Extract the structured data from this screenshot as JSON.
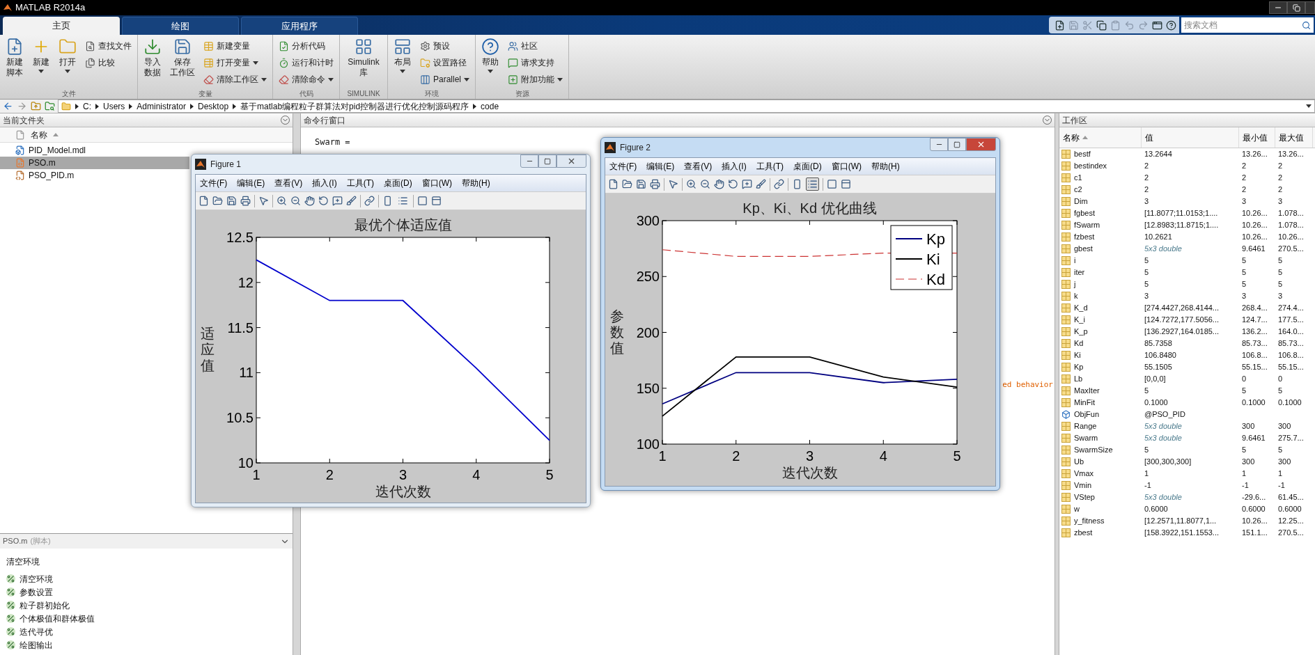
{
  "window": {
    "title": "MATLAB R2014a"
  },
  "tabs": [
    {
      "label": "主页",
      "selected": true
    },
    {
      "label": "绘图",
      "selected": false
    },
    {
      "label": "应用程序",
      "selected": false
    }
  ],
  "search": {
    "placeholder": "搜索文档"
  },
  "ribbon": {
    "groups": [
      {
        "label": "文件",
        "items": [
          {
            "kind": "large",
            "label": "新建脚本",
            "menu": false
          },
          {
            "kind": "large",
            "label": "新建",
            "menu": true
          },
          {
            "kind": "large",
            "label": "打开",
            "menu": true
          },
          {
            "kind": "small",
            "label": "查找文件",
            "menu": false
          },
          {
            "kind": "small",
            "label": "比较",
            "menu": false
          }
        ]
      },
      {
        "label": "变量",
        "items": [
          {
            "kind": "large",
            "label": "导入数据",
            "menu": false
          },
          {
            "kind": "large",
            "label": "保存工作区",
            "menu": false
          },
          {
            "kind": "small",
            "label": "新建变量",
            "menu": false
          },
          {
            "kind": "small",
            "label": "打开变量",
            "menu": true
          },
          {
            "kind": "small",
            "label": "清除工作区",
            "menu": true
          }
        ]
      },
      {
        "label": "代码",
        "items": [
          {
            "kind": "small",
            "label": "分析代码",
            "menu": false
          },
          {
            "kind": "small",
            "label": "运行和计时",
            "menu": false
          },
          {
            "kind": "small",
            "label": "清除命令",
            "menu": true
          }
        ]
      },
      {
        "label": "SIMULINK",
        "items": [
          {
            "kind": "large",
            "label": "Simulink 库",
            "menu": false
          }
        ]
      },
      {
        "label": "环境",
        "items": [
          {
            "kind": "large",
            "label": "布局",
            "menu": true
          },
          {
            "kind": "small",
            "label": "预设",
            "menu": false
          },
          {
            "kind": "small",
            "label": "设置路径",
            "menu": false
          },
          {
            "kind": "small",
            "label": "Parallel",
            "menu": true
          }
        ]
      },
      {
        "label": "资源",
        "items": [
          {
            "kind": "large",
            "label": "帮助",
            "menu": true
          },
          {
            "kind": "small",
            "label": "社区",
            "menu": false
          },
          {
            "kind": "small",
            "label": "请求支持",
            "menu": false
          },
          {
            "kind": "small",
            "label": "附加功能",
            "menu": true
          }
        ]
      }
    ]
  },
  "address_bar": {
    "crumbs": [
      "C:",
      "Users",
      "Administrator",
      "Desktop",
      "基于matlab编程粒子群算法对pid控制器进行优化控制源码程序",
      "code"
    ]
  },
  "current_folder": {
    "title": "当前文件夹",
    "column": "名称",
    "files": [
      {
        "name": "PID_Model.mdl",
        "kind": "model",
        "selected": false
      },
      {
        "name": "PSO.m",
        "kind": "script",
        "selected": true
      },
      {
        "name": "PSO_PID.m",
        "kind": "function",
        "selected": false
      }
    ]
  },
  "details": {
    "file": "PSO.m",
    "type": "(脚本)",
    "heading": "清空环境",
    "cells": [
      "清空环境",
      "参数设置",
      "粒子群初始化",
      "个体极值和群体极值",
      "迭代寻优",
      "绘图输出"
    ]
  },
  "command_window": {
    "title": "命令行窗口",
    "lines": [
      {
        "text": "Swarm =",
        "kind": "output"
      },
      {
        "text": "ed behavior",
        "kind": "warning"
      }
    ]
  },
  "workspace": {
    "title": "工作区",
    "columns": [
      "名称",
      "值",
      "最小值",
      "最大值"
    ],
    "rows": [
      {
        "name": "bestf",
        "value": "13.2644",
        "min": "13.26...",
        "max": "13.26...",
        "kind": "variable",
        "summary": false
      },
      {
        "name": "bestindex",
        "value": "2",
        "min": "2",
        "max": "2",
        "kind": "variable",
        "summary": false
      },
      {
        "name": "c1",
        "value": "2",
        "min": "2",
        "max": "2",
        "kind": "variable",
        "summary": false
      },
      {
        "name": "c2",
        "value": "2",
        "min": "2",
        "max": "2",
        "kind": "variable",
        "summary": false
      },
      {
        "name": "Dim",
        "value": "3",
        "min": "3",
        "max": "3",
        "kind": "variable",
        "summary": false
      },
      {
        "name": "fgbest",
        "value": "[11.8077;11.0153;1....",
        "min": "10.26...",
        "max": "1.078...",
        "kind": "variable",
        "summary": false
      },
      {
        "name": "fSwarm",
        "value": "[12.8983;11.8715;1....",
        "min": "10.26...",
        "max": "1.078...",
        "kind": "variable",
        "summary": false
      },
      {
        "name": "fzbest",
        "value": "10.2621",
        "min": "10.26...",
        "max": "10.26...",
        "kind": "variable",
        "summary": false
      },
      {
        "name": "gbest",
        "value": "5x3 double",
        "min": "9.6461",
        "max": "270.5...",
        "kind": "variable",
        "summary": true
      },
      {
        "name": "i",
        "value": "5",
        "min": "5",
        "max": "5",
        "kind": "variable",
        "summary": false
      },
      {
        "name": "iter",
        "value": "5",
        "min": "5",
        "max": "5",
        "kind": "variable",
        "summary": false
      },
      {
        "name": "j",
        "value": "5",
        "min": "5",
        "max": "5",
        "kind": "variable",
        "summary": false
      },
      {
        "name": "k",
        "value": "3",
        "min": "3",
        "max": "3",
        "kind": "variable",
        "summary": false
      },
      {
        "name": "K_d",
        "value": "[274.4427,268.4144...",
        "min": "268.4...",
        "max": "274.4...",
        "kind": "variable",
        "summary": false
      },
      {
        "name": "K_i",
        "value": "[124.7272,177.5056...",
        "min": "124.7...",
        "max": "177.5...",
        "kind": "variable",
        "summary": false
      },
      {
        "name": "K_p",
        "value": "[136.2927,164.0185...",
        "min": "136.2...",
        "max": "164.0...",
        "kind": "variable",
        "summary": false
      },
      {
        "name": "Kd",
        "value": "85.7358",
        "min": "85.73...",
        "max": "85.73...",
        "kind": "variable",
        "summary": false
      },
      {
        "name": "Ki",
        "value": "106.8480",
        "min": "106.8...",
        "max": "106.8...",
        "kind": "variable",
        "summary": false
      },
      {
        "name": "Kp",
        "value": "55.1505",
        "min": "55.15...",
        "max": "55.15...",
        "kind": "variable",
        "summary": false
      },
      {
        "name": "Lb",
        "value": "[0,0,0]",
        "min": "0",
        "max": "0",
        "kind": "variable",
        "summary": false
      },
      {
        "name": "MaxIter",
        "value": "5",
        "min": "5",
        "max": "5",
        "kind": "variable",
        "summary": false
      },
      {
        "name": "MinFit",
        "value": "0.1000",
        "min": "0.1000",
        "max": "0.1000",
        "kind": "variable",
        "summary": false
      },
      {
        "name": "ObjFun",
        "value": "@PSO_PID",
        "kind": "handle",
        "summary": false
      },
      {
        "name": "Range",
        "value": "5x3 double",
        "min": "300",
        "max": "300",
        "kind": "variable",
        "summary": true
      },
      {
        "name": "Swarm",
        "value": "5x3 double",
        "min": "9.6461",
        "max": "275.7...",
        "kind": "variable",
        "summary": true
      },
      {
        "name": "SwarmSize",
        "value": "5",
        "min": "5",
        "max": "5",
        "kind": "variable",
        "summary": false
      },
      {
        "name": "Ub",
        "value": "[300,300,300]",
        "min": "300",
        "max": "300",
        "kind": "variable",
        "summary": false
      },
      {
        "name": "Vmax",
        "value": "1",
        "min": "1",
        "max": "1",
        "kind": "variable",
        "summary": false
      },
      {
        "name": "Vmin",
        "value": "-1",
        "min": "-1",
        "max": "-1",
        "kind": "variable",
        "summary": false
      },
      {
        "name": "VStep",
        "value": "5x3 double",
        "min": "-29.6...",
        "max": "61.45...",
        "kind": "variable",
        "summary": true
      },
      {
        "name": "w",
        "value": "0.6000",
        "min": "0.6000",
        "max": "0.6000",
        "kind": "variable",
        "summary": false
      },
      {
        "name": "y_fitness",
        "value": "[12.2571,11.8077,1...",
        "min": "10.26...",
        "max": "12.25...",
        "kind": "variable",
        "summary": false
      },
      {
        "name": "zbest",
        "value": "[158.3922,151.1553...",
        "min": "151.1...",
        "max": "270.5...",
        "kind": "variable",
        "summary": false
      }
    ]
  },
  "figures": [
    {
      "title": "Figure 1",
      "active": false,
      "legend_button_on": false,
      "menus": [
        "文件(F)",
        "编辑(E)",
        "查看(V)",
        "插入(I)",
        "工具(T)",
        "桌面(D)",
        "窗口(W)",
        "帮助(H)"
      ],
      "chart_data": {
        "type": "line",
        "title": "最优个体适应值",
        "xlabel": "迭代次数",
        "ylabel": "适应值",
        "x": [
          1,
          2,
          3,
          4,
          5
        ],
        "xlim": [
          1,
          5
        ],
        "ylim": [
          10,
          12.5
        ],
        "xticks": [
          1,
          2,
          3,
          4,
          5
        ],
        "yticks": [
          10,
          10.5,
          11,
          11.5,
          12,
          12.5
        ],
        "series": [
          {
            "color": "#0000cc",
            "line_style": "solid",
            "values": [
              12.25,
              11.8,
              11.8,
              11.05,
              10.25
            ]
          }
        ]
      }
    },
    {
      "title": "Figure 2",
      "active": true,
      "legend_button_on": true,
      "menus": [
        "文件(F)",
        "编辑(E)",
        "查看(V)",
        "插入(I)",
        "工具(T)",
        "桌面(D)",
        "窗口(W)",
        "帮助(H)"
      ],
      "chart_data": {
        "type": "line",
        "title": "Kp、Ki、Kd 优化曲线",
        "xlabel": "迭代次数",
        "ylabel": "参数值",
        "x": [
          1,
          2,
          3,
          4,
          5
        ],
        "xlim": [
          1,
          5
        ],
        "ylim": [
          100,
          300
        ],
        "xticks": [
          1,
          2,
          3,
          4,
          5
        ],
        "yticks": [
          100,
          150,
          200,
          250,
          300
        ],
        "legend": true,
        "series": [
          {
            "name": "Kp",
            "color": "#000080",
            "line_style": "solid",
            "values": [
              136,
              164,
              164,
              155,
              158
            ]
          },
          {
            "name": "Ki",
            "color": "#000000",
            "line_style": "solid",
            "values": [
              125,
              178,
              178,
              160,
              151
            ]
          },
          {
            "name": "Kd",
            "color": "#cc3333",
            "line_style": "dashed",
            "values": [
              274,
              268,
              268,
              271,
              271
            ]
          }
        ]
      }
    }
  ]
}
